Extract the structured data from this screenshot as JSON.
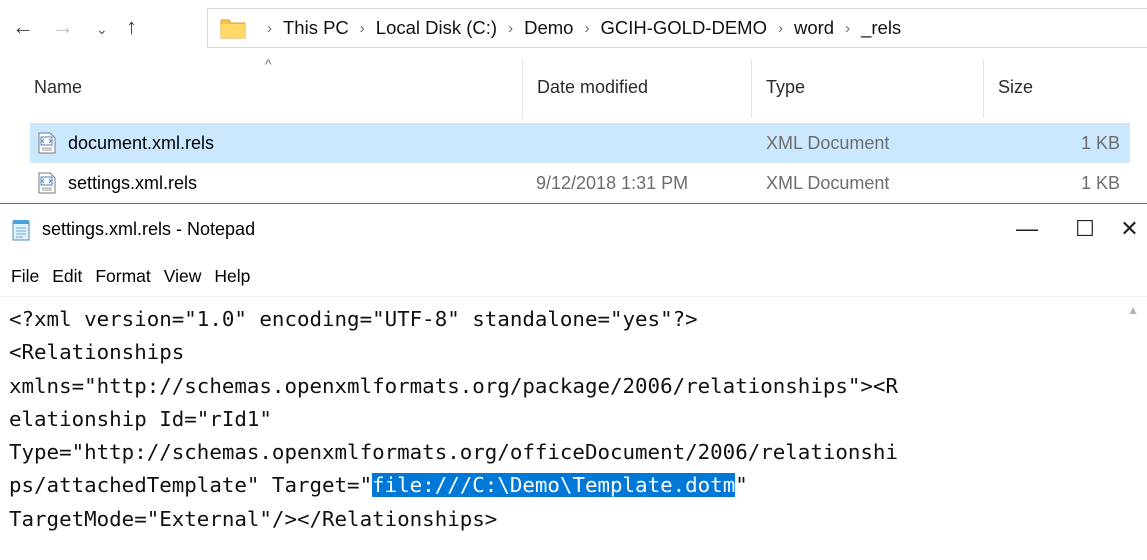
{
  "explorer": {
    "breadcrumbs": [
      "This PC",
      "Local Disk (C:)",
      "Demo",
      "GCIH-GOLD-DEMO",
      "word",
      "_rels"
    ],
    "columns": {
      "name": "Name",
      "date": "Date modified",
      "type": "Type",
      "size": "Size"
    },
    "files": [
      {
        "name": "document.xml.rels",
        "date": "",
        "type": "XML Document",
        "size": "1 KB",
        "selected": true
      },
      {
        "name": "settings.xml.rels",
        "date": "9/12/2018 1:31 PM",
        "type": "XML Document",
        "size": "1 KB",
        "selected": false
      }
    ]
  },
  "notepad": {
    "title": "settings.xml.rels - Notepad",
    "menu": [
      "File",
      "Edit",
      "Format",
      "View",
      "Help"
    ],
    "lines": [
      "<?xml version=\"1.0\" encoding=\"UTF-8\" standalone=\"yes\"?>",
      "<Relationships",
      "xmlns=\"http://schemas.openxmlformats.org/package/2006/relationships\"><R",
      "elationship Id=\"rId1\"",
      "Type=\"http://schemas.openxmlformats.org/officeDocument/2006/relationshi",
      "ps/attachedTemplate\" Target=\"",
      "TargetMode=\"External\"/></Relationships>"
    ],
    "highlight": "file:///C:\\Demo\\Template.dotm",
    "after_highlight": "\""
  },
  "icons": {
    "back": "back-arrow-icon",
    "forward": "forward-arrow-icon",
    "up": "up-arrow-icon",
    "folder": "folder-icon",
    "xml_file": "xml-file-icon",
    "notepad": "notepad-icon"
  },
  "colors": {
    "selection": "#cce8ff",
    "highlight": "#0078d7",
    "accent": "#1883d7"
  }
}
